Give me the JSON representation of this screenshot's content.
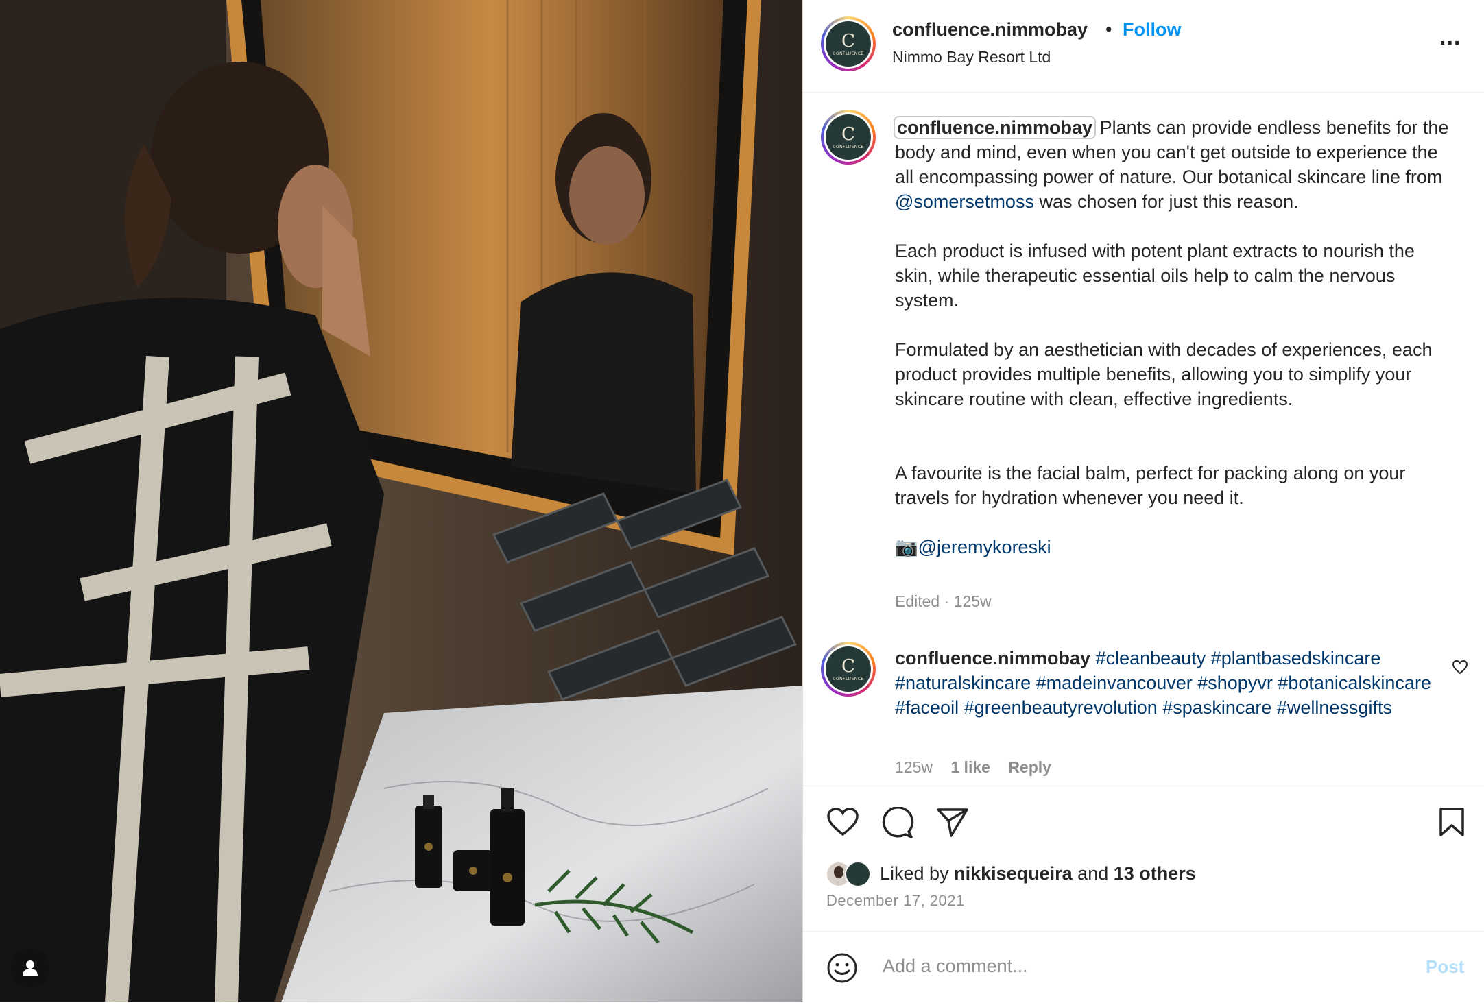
{
  "header": {
    "username": "confluence.nimmobay",
    "separator": "•",
    "follow_label": "Follow",
    "subtitle": "Nimmo Bay Resort Ltd",
    "more_label": "...",
    "avatar_wordmark": "CONFLUENCE",
    "avatar_letter": "C"
  },
  "caption": {
    "username": "confluence.nimmobay",
    "p1_before": " Plants can provide endless benefits for the body and mind, even when you can't get outside to experience the all encompassing power of nature. Our botanical skincare line from ",
    "p1_mention": "@somersetmoss",
    "p1_after": " was chosen for just this reason.",
    "p2": "Each product is infused with potent plant extracts to nourish the skin, while therapeutic essential oils help to calm the nervous system.",
    "p3": "Formulated by an aesthetician with decades of experiences, each product provides multiple benefits, allowing you to simplify your skincare routine with clean, effective ingredients.",
    "p4": "A favourite is the facial balm, perfect for packing along on your travels for hydration whenever you need it.",
    "p5_camera": "📷",
    "p5_mention": "@jeremykoreski",
    "meta": "Edited · 125w"
  },
  "comment": {
    "username": "confluence.nimmobay",
    "hashtags": "#cleanbeauty #plantbasedskincare #naturalskincare #madeinvancouver #shopyvr #botanicalskincare #faceoil #greenbeautyrevolution #spaskincare #wellnessgifts",
    "time": "125w",
    "likes": "1 like",
    "reply": "Reply"
  },
  "actions": {
    "liked_prefix": "Liked by ",
    "liked_user": "nikkisequeira",
    "liked_mid": " and ",
    "liked_others": "13 others",
    "date": "December 17, 2021"
  },
  "comment_box": {
    "placeholder": "Add a comment...",
    "post_label": "Post"
  },
  "colors": {
    "follow": "#0095f6",
    "mention": "#00376b",
    "muted": "#8e8e8e",
    "post_disabled": "#b2dffc"
  }
}
